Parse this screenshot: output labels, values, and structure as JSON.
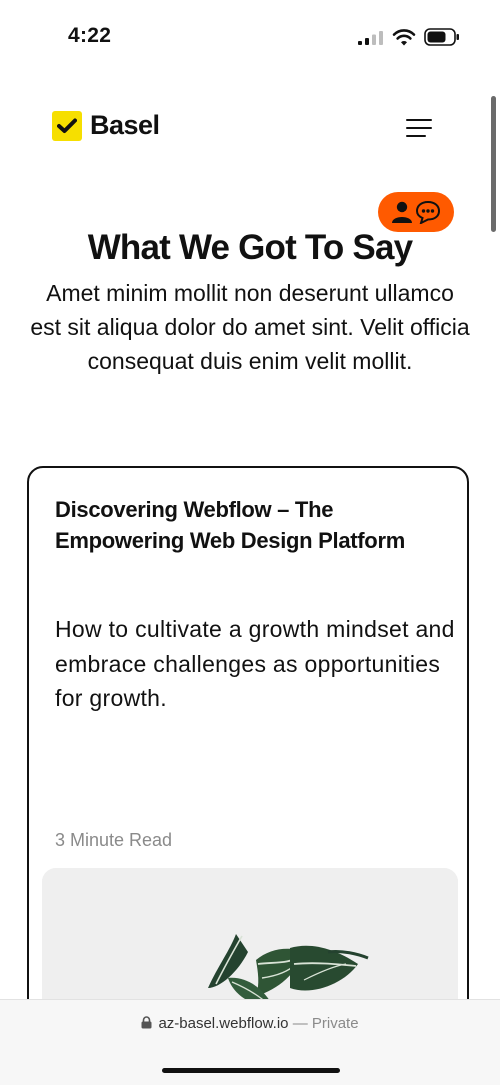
{
  "status_bar": {
    "time": "4:22"
  },
  "header": {
    "brand": "Basel"
  },
  "hero": {
    "title": "What We Got To Say",
    "subtitle": "Amet minim mollit non deserunt ullamco est sit aliqua dolor do amet sint. Velit officia consequat duis enim velit mollit."
  },
  "card": {
    "title": "Discovering Webflow – The Empowering Web Design Platform",
    "description": "How to cultivate a growth mindset and embrace challenges as opportunities for growth.",
    "read_time": "3 Minute Read"
  },
  "browser": {
    "domain": "az-basel.webflow.io",
    "separator": "—",
    "mode": "Private"
  },
  "colors": {
    "accent": "#ff5a00",
    "brand": "#f6df00",
    "text": "#111111",
    "muted": "#8a8a8a"
  },
  "icons": [
    "signal-icon",
    "wifi-icon",
    "battery-icon",
    "checkmark-icon",
    "hamburger-menu-icon",
    "person-icon",
    "chat-bubble-icon",
    "lock-icon"
  ]
}
